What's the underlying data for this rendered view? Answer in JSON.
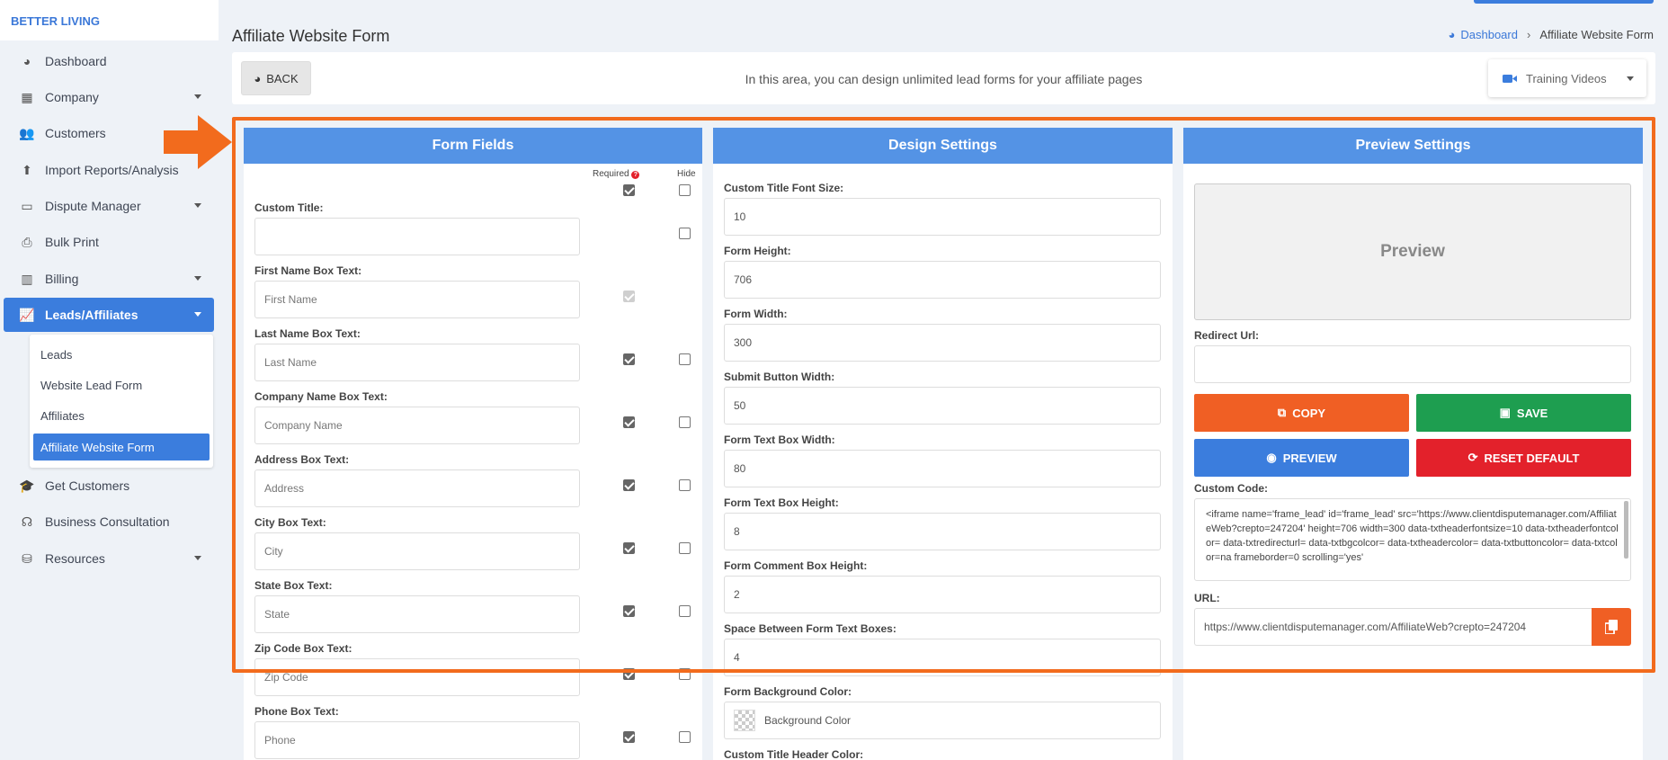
{
  "brand": "BETTER LIVING",
  "sidebar": {
    "items": [
      {
        "label": "Dashboard",
        "icon": "pie-chart-icon",
        "glyph": "◕",
        "caret": false
      },
      {
        "label": "Company",
        "icon": "building-icon",
        "glyph": "▦",
        "caret": true
      },
      {
        "label": "Customers",
        "icon": "users-icon",
        "glyph": "👥",
        "caret": false
      },
      {
        "label": "Import Reports/Analysis",
        "icon": "file-upload-icon",
        "glyph": "⬆",
        "caret": false
      },
      {
        "label": "Dispute Manager",
        "icon": "laptop-icon",
        "glyph": "▭",
        "caret": true
      },
      {
        "label": "Bulk Print",
        "icon": "printer-icon",
        "glyph": "⎙",
        "caret": false
      },
      {
        "label": "Billing",
        "icon": "billing-icon",
        "glyph": "▥",
        "caret": true
      },
      {
        "label": "Leads/Affiliates",
        "icon": "chart-line-icon",
        "glyph": "📈",
        "caret": true
      },
      {
        "label": "Get Customers",
        "icon": "graduation-cap-icon",
        "glyph": "🎓",
        "caret": false
      },
      {
        "label": "Business Consultation",
        "icon": "headset-icon",
        "glyph": "☊",
        "caret": false
      },
      {
        "label": "Resources",
        "icon": "resources-icon",
        "glyph": "⛁",
        "caret": true
      }
    ],
    "submenu": [
      "Leads",
      "Website Lead Form",
      "Affiliates",
      "Affiliate Website Form"
    ]
  },
  "header": {
    "title": "Affiliate Website Form",
    "breadcrumb_home": "Dashboard",
    "breadcrumb_current": "Affiliate Website Form"
  },
  "toolbar": {
    "back_label": "BACK",
    "message": "In this area, you can design unlimited lead forms for your affiliate pages",
    "training_label": "Training Videos"
  },
  "form_fields": {
    "title": "Form Fields",
    "required_label": "Required",
    "hide_label": "Hide",
    "fields": [
      {
        "label": "Custom Title:",
        "placeholder": ""
      },
      {
        "label": "First Name Box Text:",
        "placeholder": "First Name"
      },
      {
        "label": "Last Name Box Text:",
        "placeholder": "Last Name"
      },
      {
        "label": "Company Name Box Text:",
        "placeholder": "Company Name"
      },
      {
        "label": "Address Box Text:",
        "placeholder": "Address"
      },
      {
        "label": "City Box Text:",
        "placeholder": "City"
      },
      {
        "label": "State Box Text:",
        "placeholder": "State"
      },
      {
        "label": "Zip Code Box Text:",
        "placeholder": "Zip Code"
      },
      {
        "label": "Phone Box Text:",
        "placeholder": "Phone"
      }
    ]
  },
  "design_settings": {
    "title": "Design Settings",
    "fields": [
      {
        "label": "Custom Title Font Size:",
        "value": "10"
      },
      {
        "label": "Form Height:",
        "value": "706"
      },
      {
        "label": "Form Width:",
        "value": "300"
      },
      {
        "label": "Submit Button Width:",
        "value": "50"
      },
      {
        "label": "Form Text Box Width:",
        "value": "80"
      },
      {
        "label": "Form Text Box Height:",
        "value": "8"
      },
      {
        "label": "Form Comment Box Height:",
        "value": "2"
      },
      {
        "label": "Space Between Form Text Boxes:",
        "value": "4"
      },
      {
        "label": "Form Background Color:",
        "value": "Background Color"
      },
      {
        "label": "Custom Title Header Color:",
        "value": ""
      }
    ]
  },
  "preview_settings": {
    "title": "Preview Settings",
    "preview_text": "Preview",
    "redirect_label": "Redirect Url:",
    "copy_label": "COPY",
    "save_label": "SAVE",
    "preview_label": "PREVIEW",
    "reset_label": "RESET DEFAULT",
    "custom_code_label": "Custom Code:",
    "custom_code": "<iframe name='frame_lead' id='frame_lead' src='https://www.clientdisputemanager.com/AffiliateWeb?crepto=247204' height=706 width=300 data-txtheaderfontsize=10 data-txtheaderfontcolor= data-txtredirecturl= data-txtbgcolcor= data-txtheadercolor= data-txtbuttoncolor= data-txtcolor=na frameborder=0  scrolling='yes'",
    "url_label": "URL:",
    "url_value": "https://www.clientdisputemanager.com/AffiliateWeb?crepto=247204"
  },
  "colors": {
    "accent": "#3b7ddd",
    "panel_header": "#5493e5",
    "highlight": "#f26b1d",
    "copy": "#f05f24",
    "save": "#1e9e50",
    "reset": "#e3212b"
  }
}
